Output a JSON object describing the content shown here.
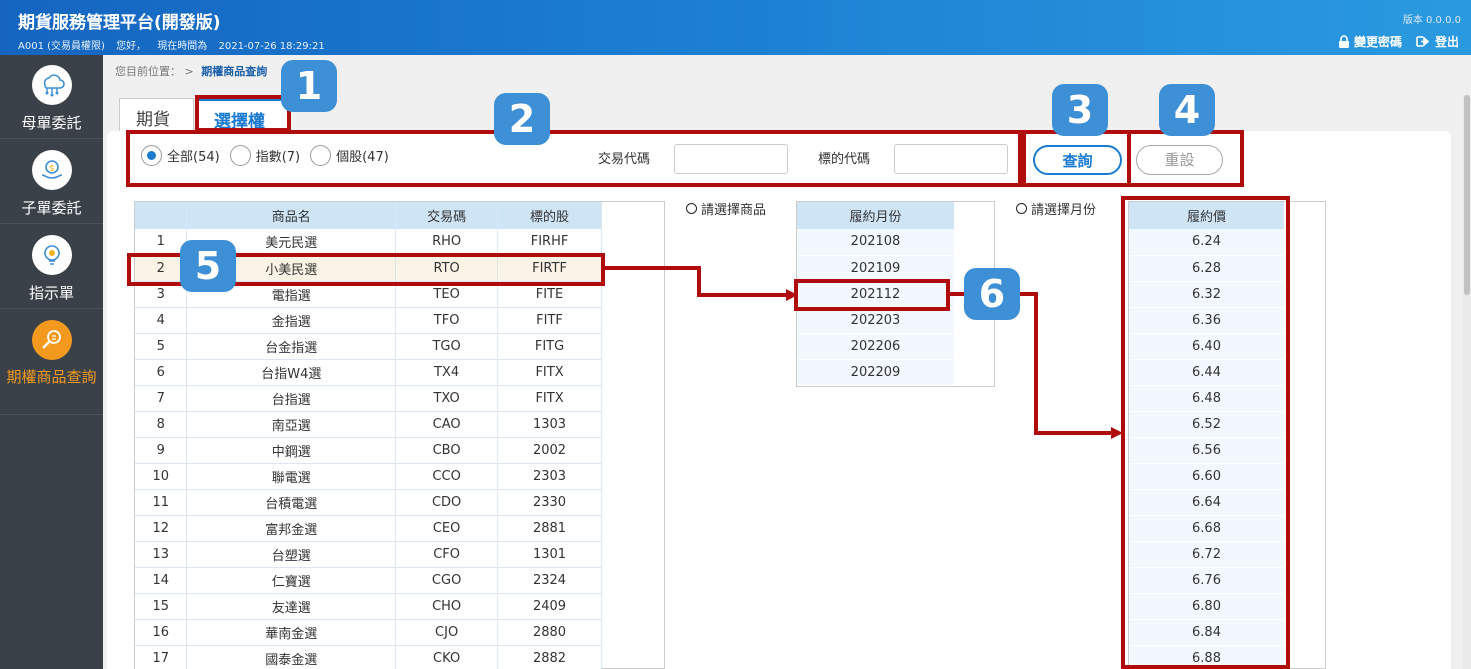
{
  "header": {
    "title": "期貨服務管理平台(開發版)",
    "account": "A001 (交易員權限)",
    "greeting": "您好，",
    "time_label": "現在時間為",
    "time": "2021-07-26 18:29:21",
    "version": "版本 0.0.0.0",
    "change_password": "變更密碼",
    "logout": "登出"
  },
  "sidebar": {
    "items": [
      {
        "label": "母單委託",
        "icon": "cloud-network-icon"
      },
      {
        "label": "子單委託",
        "icon": "money-hand-icon"
      },
      {
        "label": "指示單",
        "icon": "lightbulb-icon"
      },
      {
        "label": "期權商品查詢",
        "icon": "search-doc-icon"
      }
    ]
  },
  "breadcrumb": {
    "prefix": "您目前位置：",
    "sep": ">",
    "current": "期權商品查詢"
  },
  "tabs": [
    {
      "label": "期貨"
    },
    {
      "label": "選擇權"
    }
  ],
  "filters": {
    "radios": [
      {
        "label": "全部(54)"
      },
      {
        "label": "指數(7)"
      },
      {
        "label": "個股(47)"
      }
    ],
    "trade_code_label": "交易代碼",
    "trade_code_value": "",
    "underlying_code_label": "標的代碼",
    "underlying_code_value": "",
    "query_button": "查詢",
    "reset_button": "重設"
  },
  "product_table": {
    "headers": [
      "",
      "商品名",
      "交易碼",
      "標的股"
    ],
    "rows": [
      [
        "1",
        "美元民選",
        "RHO",
        "FIRHF"
      ],
      [
        "2",
        "小美民選",
        "RTO",
        "FIRTF"
      ],
      [
        "3",
        "電指選",
        "TEO",
        "FITE"
      ],
      [
        "4",
        "金指選",
        "TFO",
        "FITF"
      ],
      [
        "5",
        "台金指選",
        "TGO",
        "FITG"
      ],
      [
        "6",
        "台指W4選",
        "TX4",
        "FITX"
      ],
      [
        "7",
        "台指選",
        "TXO",
        "FITX"
      ],
      [
        "8",
        "南亞選",
        "CAO",
        "1303"
      ],
      [
        "9",
        "中鋼選",
        "CBO",
        "2002"
      ],
      [
        "10",
        "聯電選",
        "CCO",
        "2303"
      ],
      [
        "11",
        "台積電選",
        "CDO",
        "2330"
      ],
      [
        "12",
        "富邦金選",
        "CEO",
        "2881"
      ],
      [
        "13",
        "台塑選",
        "CFO",
        "1301"
      ],
      [
        "14",
        "仁寶選",
        "CGO",
        "2324"
      ],
      [
        "15",
        "友達選",
        "CHO",
        "2409"
      ],
      [
        "16",
        "華南金選",
        "CJO",
        "2880"
      ],
      [
        "17",
        "國泰金選",
        "CKO",
        "2882"
      ]
    ]
  },
  "month_panel": {
    "hint": "請選擇商品",
    "header": "履約月份",
    "rows": [
      "202108",
      "202109",
      "202112",
      "202203",
      "202206",
      "202209"
    ]
  },
  "price_panel": {
    "hint": "請選擇月份",
    "header": "履約價",
    "rows": [
      "6.24",
      "6.28",
      "6.32",
      "6.36",
      "6.40",
      "6.44",
      "6.48",
      "6.52",
      "6.56",
      "6.60",
      "6.64",
      "6.68",
      "6.72",
      "6.76",
      "6.80",
      "6.84",
      "6.88"
    ]
  },
  "markers": [
    "1",
    "2",
    "3",
    "4",
    "5",
    "6"
  ],
  "colors": {
    "header_blue": "#1a7bd0",
    "sidebar_bg": "#3b4148",
    "active_orange": "#f39a1e",
    "annotation_red": "#b00c0c",
    "marker_blue": "#3d8fd6"
  }
}
